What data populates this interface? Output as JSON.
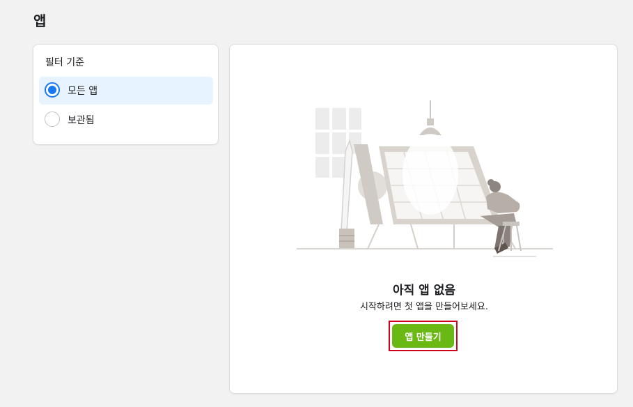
{
  "page": {
    "title": "앱"
  },
  "filter": {
    "title": "필터 기준",
    "options": [
      {
        "label": "모든 앱",
        "selected": true
      },
      {
        "label": "보관됨",
        "selected": false
      }
    ]
  },
  "empty_state": {
    "title": "아직 앱 없음",
    "subtitle": "시작하려면 첫 앱을 만들어보세요.",
    "cta_label": "앱 만들기"
  },
  "colors": {
    "accent_blue": "#1877f2",
    "selected_bg": "#e7f3ff",
    "cta_green": "#69b814",
    "highlight_red": "#d0021b",
    "page_bg": "#f2f2f2"
  }
}
